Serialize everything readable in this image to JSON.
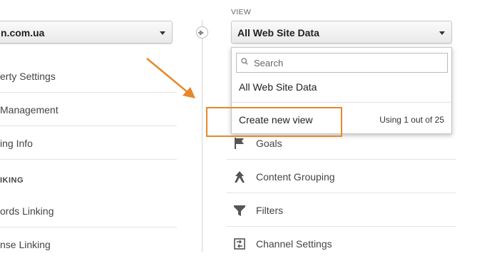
{
  "property_column": {
    "selected_property": "n.com.ua",
    "items": [
      {
        "label": "erty Settings"
      },
      {
        "label": "Management"
      },
      {
        "label": "ing Info"
      }
    ],
    "section_heading": "IKING",
    "linking_items": [
      {
        "label": "ords Linking"
      },
      {
        "label": "nse Linking"
      }
    ]
  },
  "view_column": {
    "label": "VIEW",
    "selected_view": "All Web Site Data",
    "items": [
      {
        "label": "Goals",
        "icon": "flag-icon"
      },
      {
        "label": "Content Grouping",
        "icon": "content-grouping-icon"
      },
      {
        "label": "Filters",
        "icon": "filter-icon"
      },
      {
        "label": "Channel Settings",
        "icon": "channel-settings-icon"
      }
    ]
  },
  "view_dropdown": {
    "search_placeholder": "Search",
    "options": [
      {
        "label": "All Web Site Data"
      }
    ],
    "create_label": "Create new view",
    "usage_text": "Using 1 out of 25"
  },
  "colors": {
    "annotation_orange": "#e8872b",
    "divider": "#e3e3e3"
  }
}
